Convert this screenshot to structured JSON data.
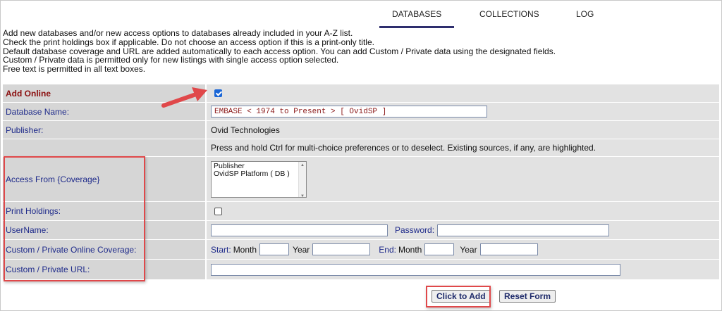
{
  "tabs": [
    {
      "label": "DATABASES",
      "active": true
    },
    {
      "label": "COLLECTIONS",
      "active": false
    },
    {
      "label": "LOG",
      "active": false
    }
  ],
  "intro_lines": [
    "Add new databases and/or new access options to databases already included in your A-Z list.",
    "Check the print holdings box if applicable. Do not choose an access option if this is a print-only title.",
    "Default database coverage and URL are added automatically to each access option. You can add Custom / Private data using the designated fields.",
    "Custom / Private data is permitted only for new listings with single access option selected.",
    "Free text is permitted in all text boxes."
  ],
  "form": {
    "add_online_label": "Add Online",
    "add_online_checked": true,
    "database_name_label": "Database Name:",
    "database_name_value": "EMBASE < 1974 to Present > [ OvidSP ]",
    "publisher_label": "Publisher:",
    "publisher_value": "Ovid Technologies",
    "hint": "Press and hold Ctrl for multi-choice preferences or to deselect. Existing sources, if any, are highlighted.",
    "access_from_label": "Access From {Coverage}",
    "access_options": [
      "Publisher",
      "OvidSP Platform ( DB )"
    ],
    "print_holdings_label": "Print Holdings:",
    "print_holdings_checked": false,
    "username_label": "UserName:",
    "password_label": "Password:",
    "custom_coverage_label": "Custom / Private Online Coverage:",
    "start_label": "Start:",
    "end_label": "End:",
    "month_label": "Month",
    "year_label": "Year",
    "custom_url_label": "Custom / Private URL:"
  },
  "buttons": {
    "add": "Click to Add",
    "reset": "Reset Form"
  },
  "colors": {
    "accent_annotation": "#e0484a",
    "label_blue": "#1e2a8a",
    "label_red": "#8b1010"
  }
}
